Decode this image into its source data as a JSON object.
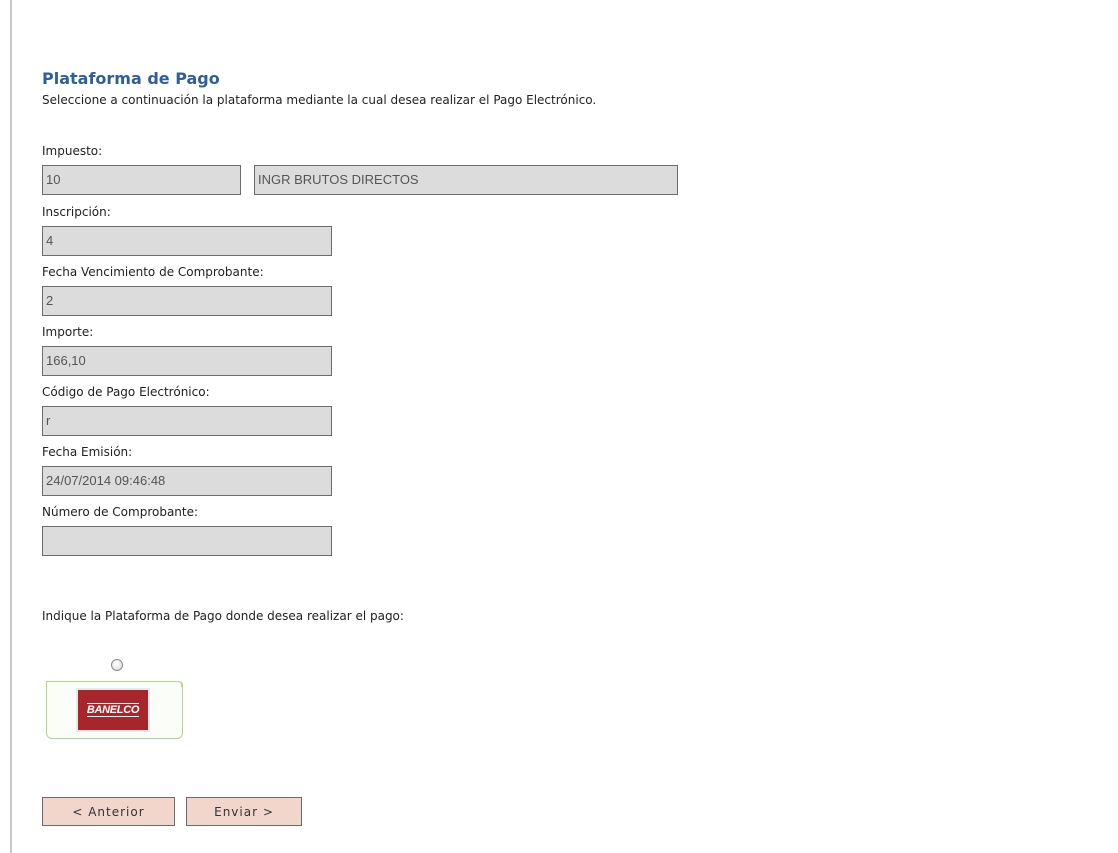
{
  "header": {
    "title": "Plataforma de Pago",
    "subtitle": "Seleccione a continuación la plataforma mediante la cual desea realizar el Pago Electrónico."
  },
  "form": {
    "impuesto": {
      "label": "Impuesto:",
      "code": "10",
      "description": "INGR BRUTOS DIRECTOS"
    },
    "inscripcion": {
      "label": "Inscripción:",
      "value": "4"
    },
    "fecha_vencimiento": {
      "label": "Fecha Vencimiento de Comprobante:",
      "value": "2"
    },
    "importe": {
      "label": "Importe:",
      "value": "166,10"
    },
    "codigo_pago": {
      "label": "Código de Pago Electrónico:",
      "value": "r"
    },
    "fecha_emision": {
      "label": "Fecha Emisión:",
      "value": "24/07/2014 09:46:48"
    },
    "numero_comprobante": {
      "label": "Número de Comprobante:",
      "value": ""
    }
  },
  "platform": {
    "prompt": "Indique la Plataforma de Pago donde desea realizar el pago:",
    "options": [
      {
        "logo_text": "BANELCO",
        "selected": false
      }
    ]
  },
  "buttons": {
    "back": "< Anterior",
    "submit": "Enviar >"
  },
  "colors": {
    "title": "#2f5e9e",
    "field_bg": "#dcdcdc",
    "button_bg": "#f2d6cc",
    "banelco_red": "#a8262b",
    "card_border": "#b7d48c"
  }
}
